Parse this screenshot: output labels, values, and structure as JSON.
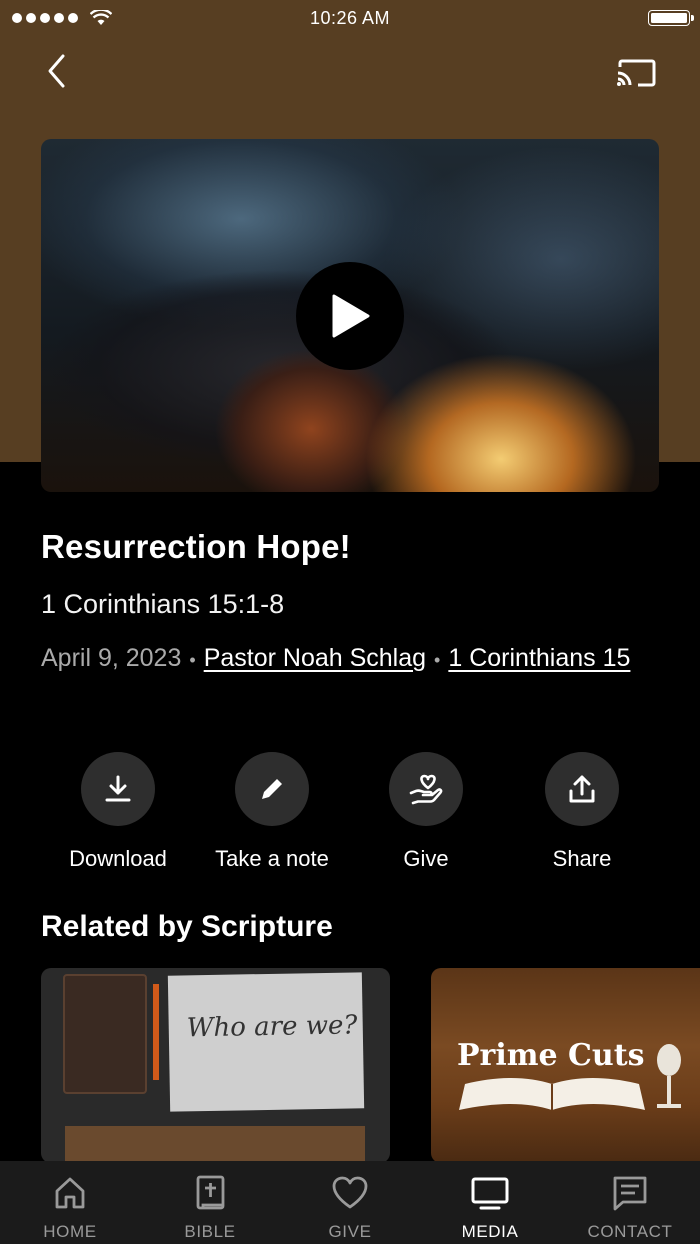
{
  "status_bar": {
    "time": "10:26 AM"
  },
  "header": {
    "back_icon": "chevron-left-icon",
    "cast_icon": "cast-icon"
  },
  "colors": {
    "header_bg": "#573e22",
    "page_bg": "#000000",
    "tab_bar_bg": "#1b1b1b"
  },
  "media": {
    "title": "Resurrection Hope!",
    "subtitle": "1 Corinthians 15:1-8",
    "date": "April 9, 2023",
    "speaker": "Pastor Noah Schlag",
    "series": "1 Corinthians 15"
  },
  "actions": [
    {
      "label": "Download",
      "icon": "download-icon"
    },
    {
      "label": "Take a note",
      "icon": "pencil-icon"
    },
    {
      "label": "Give",
      "icon": "heart-hand-icon"
    },
    {
      "label": "Share",
      "icon": "share-icon"
    }
  ],
  "related": {
    "heading": "Related by Scripture",
    "cards": [
      {
        "art_text": "Who are we?"
      },
      {
        "art_text": "Prime Cuts"
      }
    ]
  },
  "tabs": [
    {
      "label": "HOME",
      "icon": "home-icon"
    },
    {
      "label": "BIBLE",
      "icon": "bible-icon"
    },
    {
      "label": "GIVE",
      "icon": "heart-icon"
    },
    {
      "label": "MEDIA",
      "icon": "tv-icon",
      "active": true
    },
    {
      "label": "CONTACT",
      "icon": "chat-icon"
    }
  ]
}
